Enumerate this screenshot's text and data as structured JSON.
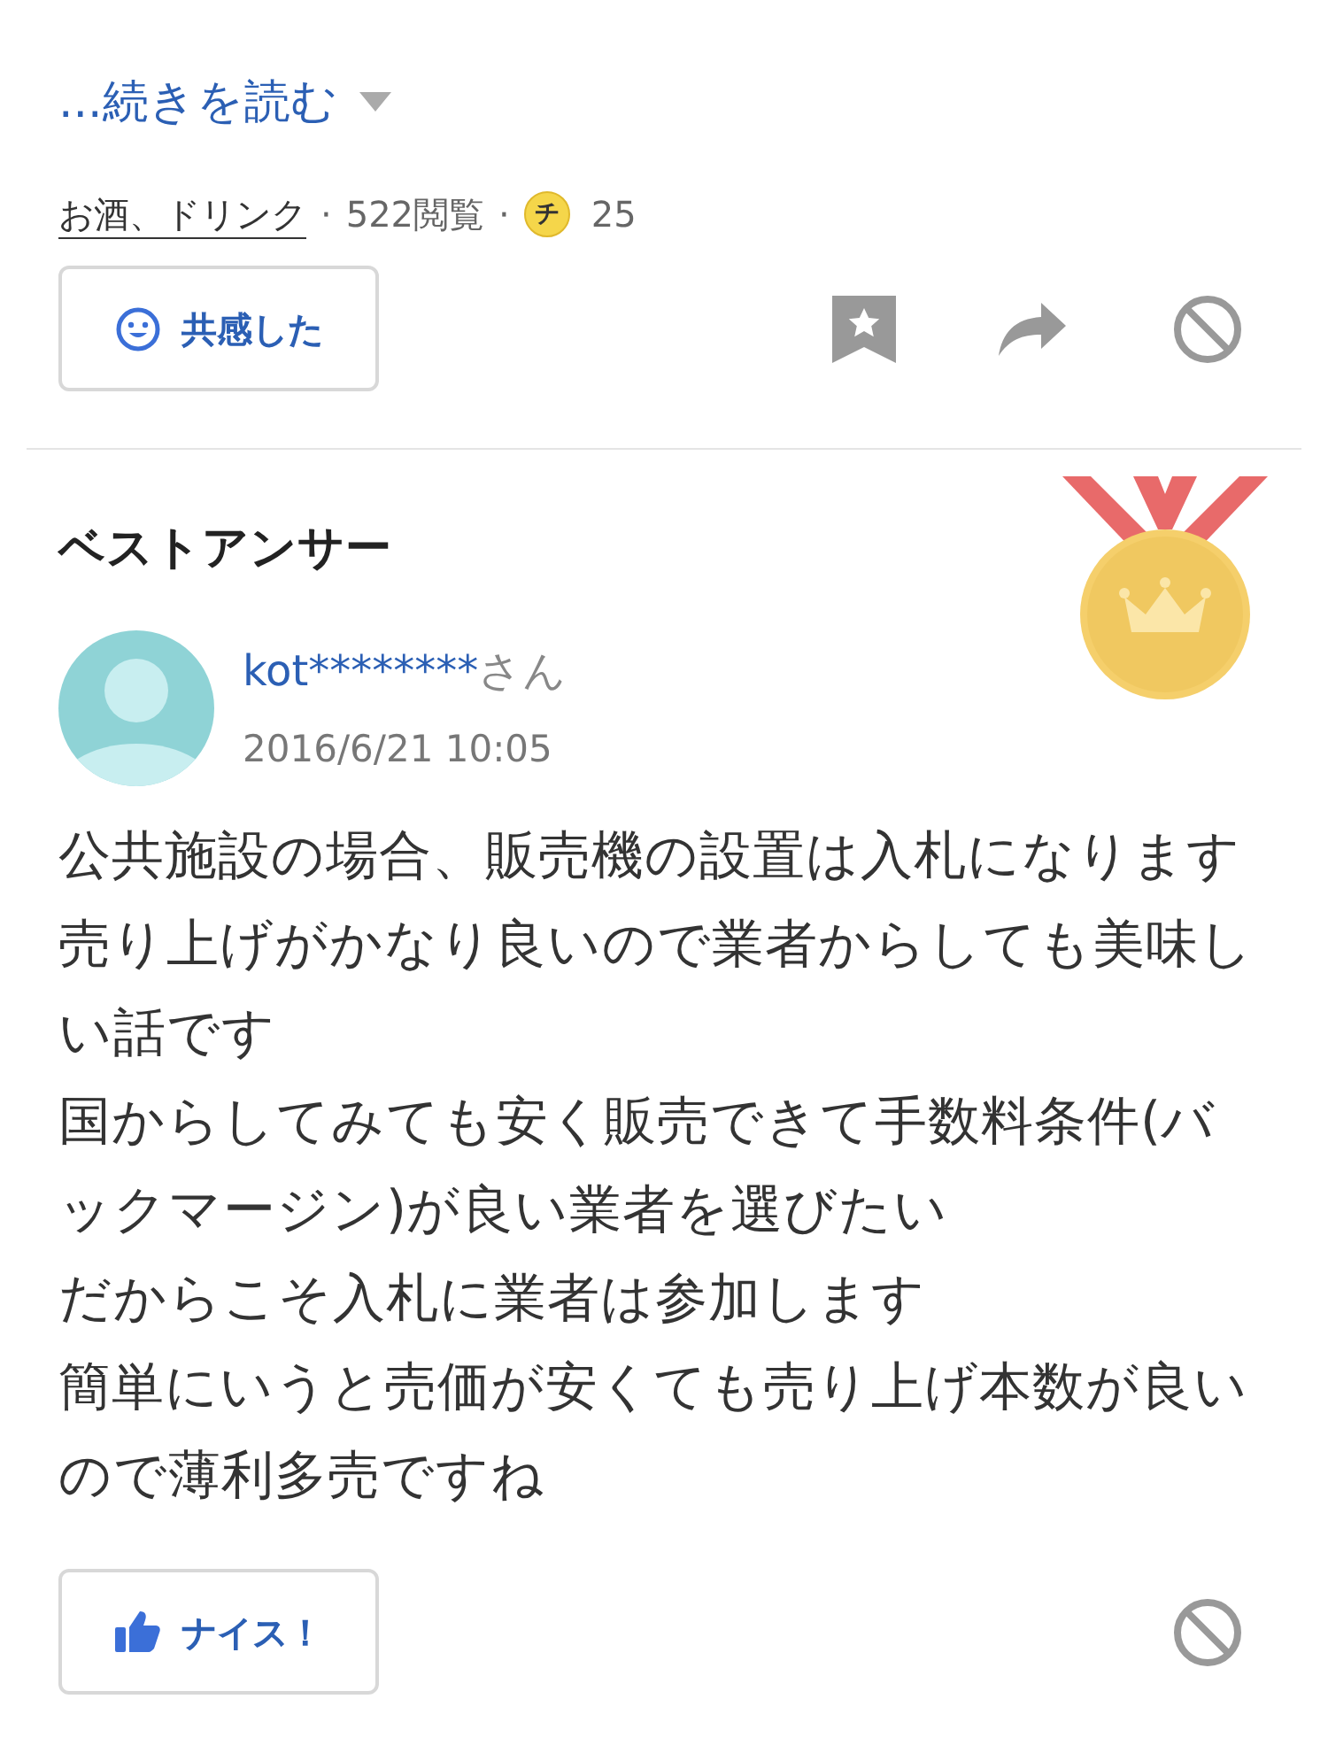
{
  "read_more": {
    "label": "...続きを読む"
  },
  "meta": {
    "category": "お酒、ドリンク",
    "separator_1": "·",
    "views": "522閲覧",
    "separator_2": "·",
    "coin_badge": "チ",
    "coins": "25"
  },
  "question_actions": {
    "empathy_button": "共感した"
  },
  "best_answer": {
    "heading": "ベストアンサー",
    "user": {
      "name": "kot********",
      "suffix": "さん",
      "date": "2016/6/21 10:05"
    },
    "body": [
      "公共施設の場合、販売機の設置は入札になります",
      "売り上げがかなり良いので業者からしても美味しい話です",
      "国からしてみても安く販売できて手数料条件(バックマージン)が良い業者を選びたい",
      "だからこそ入札に業者は参加します",
      "簡単にいうと売価が安くても売り上げ本数が良いので薄利多売ですね"
    ],
    "nice_button": "ナイス！"
  }
}
